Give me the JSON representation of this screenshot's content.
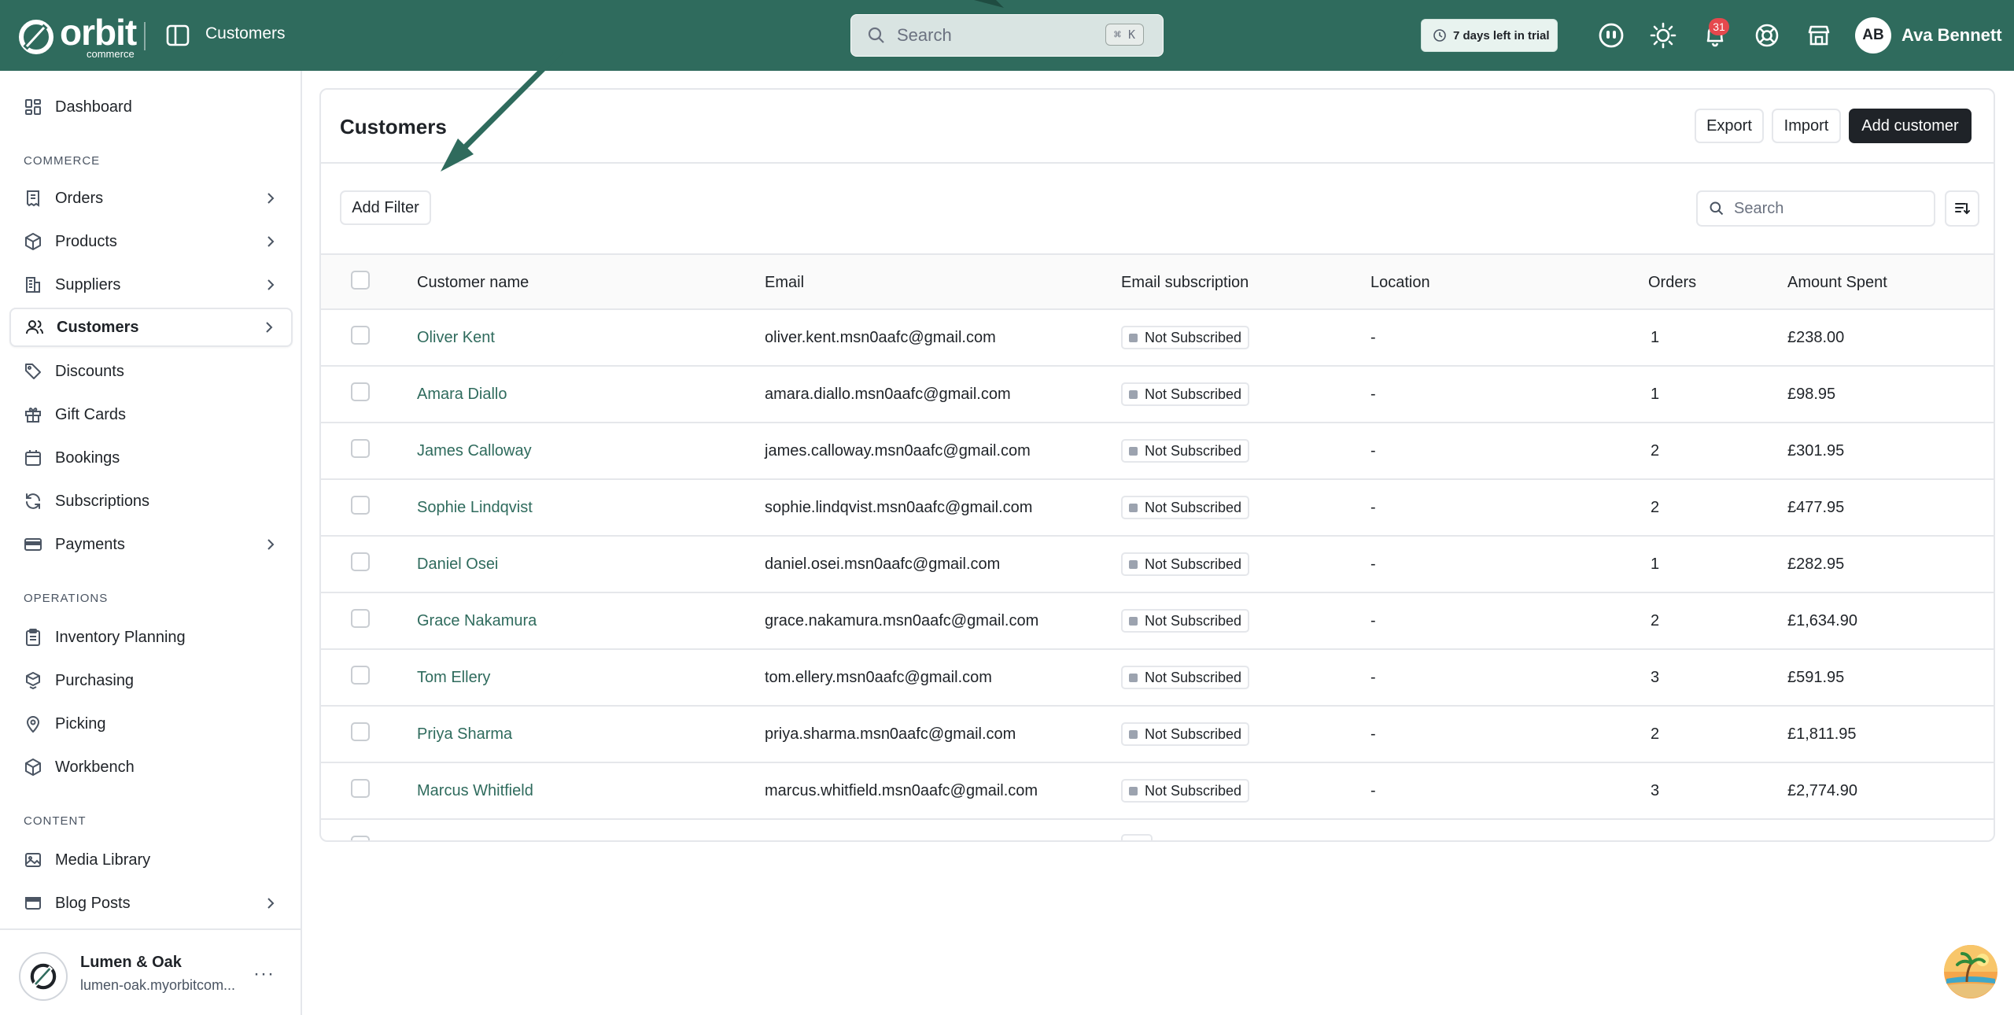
{
  "topbar": {
    "brand_word": "orbit",
    "brand_sub": "commerce",
    "page_crumb": "Customers",
    "search_placeholder": "Search",
    "search_shortcut": "⌘ K",
    "trial_text": "7 days left in trial",
    "notification_count": "31",
    "avatar_initials": "AB",
    "user_name": "Ava Bennett"
  },
  "sidebar": {
    "dashboard": "Dashboard",
    "section_commerce": "COMMERCE",
    "orders": "Orders",
    "products": "Products",
    "suppliers": "Suppliers",
    "customers": "Customers",
    "discounts": "Discounts",
    "gift_cards": "Gift Cards",
    "bookings": "Bookings",
    "subscriptions": "Subscriptions",
    "payments": "Payments",
    "section_operations": "OPERATIONS",
    "inventory_planning": "Inventory Planning",
    "purchasing": "Purchasing",
    "picking": "Picking",
    "workbench": "Workbench",
    "section_content": "CONTENT",
    "media_library": "Media Library",
    "blog_posts": "Blog Posts",
    "store_name": "Lumen & Oak",
    "store_url": "lumen-oak.myorbitcom..."
  },
  "main": {
    "title": "Customers",
    "export_label": "Export",
    "import_label": "Import",
    "add_customer_label": "Add customer",
    "add_filter_label": "Add Filter",
    "table_search_placeholder": "Search",
    "columns": {
      "name": "Customer name",
      "email": "Email",
      "subscription": "Email subscription",
      "location": "Location",
      "orders": "Orders",
      "amount": "Amount Spent"
    },
    "rows": [
      {
        "name": "Oliver Kent",
        "email": "oliver.kent.msn0aafc@gmail.com",
        "subscription": "Not Subscribed",
        "location": "-",
        "orders": "1",
        "amount": "£238.00"
      },
      {
        "name": "Amara Diallo",
        "email": "amara.diallo.msn0aafc@gmail.com",
        "subscription": "Not Subscribed",
        "location": "-",
        "orders": "1",
        "amount": "£98.95"
      },
      {
        "name": "James Calloway",
        "email": "james.calloway.msn0aafc@gmail.com",
        "subscription": "Not Subscribed",
        "location": "-",
        "orders": "2",
        "amount": "£301.95"
      },
      {
        "name": "Sophie Lindqvist",
        "email": "sophie.lindqvist.msn0aafc@gmail.com",
        "subscription": "Not Subscribed",
        "location": "-",
        "orders": "2",
        "amount": "£477.95"
      },
      {
        "name": "Daniel Osei",
        "email": "daniel.osei.msn0aafc@gmail.com",
        "subscription": "Not Subscribed",
        "location": "-",
        "orders": "1",
        "amount": "£282.95"
      },
      {
        "name": "Grace Nakamura",
        "email": "grace.nakamura.msn0aafc@gmail.com",
        "subscription": "Not Subscribed",
        "location": "-",
        "orders": "2",
        "amount": "£1,634.90"
      },
      {
        "name": "Tom Ellery",
        "email": "tom.ellery.msn0aafc@gmail.com",
        "subscription": "Not Subscribed",
        "location": "-",
        "orders": "3",
        "amount": "£591.95"
      },
      {
        "name": "Priya Sharma",
        "email": "priya.sharma.msn0aafc@gmail.com",
        "subscription": "Not Subscribed",
        "location": "-",
        "orders": "2",
        "amount": "£1,811.95"
      },
      {
        "name": "Marcus Whitfield",
        "email": "marcus.whitfield.msn0aafc@gmail.com",
        "subscription": "Not Subscribed",
        "location": "-",
        "orders": "3",
        "amount": "£2,774.90"
      }
    ]
  },
  "colors": {
    "brand": "#2f6b5d",
    "link": "#2f6b5d",
    "badge": "#e5484d",
    "primary_button": "#1f2328"
  },
  "icons": [
    "orbit-logo-icon",
    "sidebar-toggle-icon",
    "search-icon",
    "clock-icon",
    "alien-icon",
    "sun-icon",
    "bell-icon",
    "help-icon",
    "store-icon",
    "sort-icon",
    "chevron-right-icon",
    "annotation-arrow"
  ]
}
